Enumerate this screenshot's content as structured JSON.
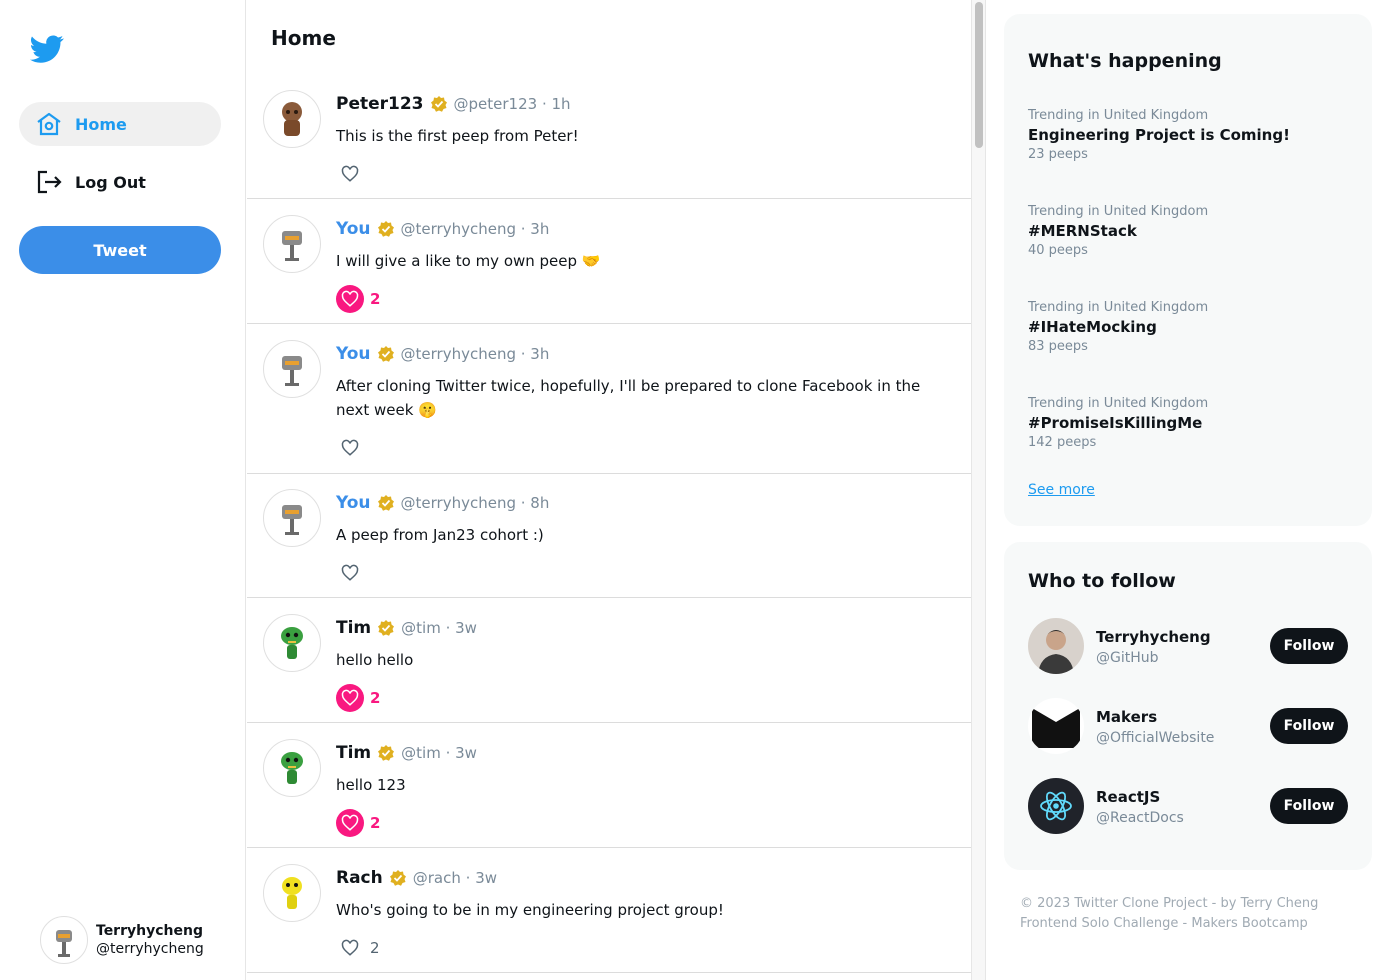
{
  "sidebar": {
    "nav": [
      {
        "label": "Home",
        "icon": "home-icon",
        "active": true
      },
      {
        "label": "Log Out",
        "icon": "logout-icon",
        "active": false
      }
    ],
    "tweet_label": "Tweet",
    "me": {
      "name": "Terryhycheng",
      "handle": "@terryhycheng"
    }
  },
  "feed": {
    "title": "Home",
    "peeps": [
      {
        "name": "Peter123",
        "you": false,
        "handle": "@peter123",
        "time": "1h",
        "text": "This is the first peep from Peter!",
        "likes": "",
        "liked": false
      },
      {
        "name": "You",
        "you": true,
        "handle": "@terryhycheng",
        "time": "3h",
        "text": "I will give a like to my own peep 🤝",
        "likes": "2",
        "liked": true
      },
      {
        "name": "You",
        "you": true,
        "handle": "@terryhycheng",
        "time": "3h",
        "text": "After cloning Twitter twice, hopefully, I'll be prepared to clone Facebook in the next week 🤫",
        "likes": "",
        "liked": false
      },
      {
        "name": "You",
        "you": true,
        "handle": "@terryhycheng",
        "time": "8h",
        "text": "A peep from Jan23 cohort :)",
        "likes": "",
        "liked": false
      },
      {
        "name": "Tim",
        "you": false,
        "handle": "@tim",
        "time": "3w",
        "text": "hello hello",
        "likes": "2",
        "liked": true
      },
      {
        "name": "Tim",
        "you": false,
        "handle": "@tim",
        "time": "3w",
        "text": "hello 123",
        "likes": "2",
        "liked": true
      },
      {
        "name": "Rach",
        "you": false,
        "handle": "@rach",
        "time": "3w",
        "text": "Who's going to be in my engineering project group!",
        "likes": "2",
        "liked": false
      }
    ]
  },
  "trends": {
    "title": "What's happening",
    "items": [
      {
        "context": "Trending in United Kingdom",
        "tag": "Engineering Project is Coming!",
        "count": "23 peeps"
      },
      {
        "context": "Trending in United Kingdom",
        "tag": "#MERNStack",
        "count": "40 peeps"
      },
      {
        "context": "Trending in United Kingdom",
        "tag": "#IHateMocking",
        "count": "83 peeps"
      },
      {
        "context": "Trending in United Kingdom",
        "tag": "#PromiseIsKillingMe",
        "count": "142 peeps"
      }
    ],
    "see_more": "See more"
  },
  "who_to_follow": {
    "title": "Who to follow",
    "items": [
      {
        "name": "Terryhycheng",
        "handle": "@GitHub",
        "button": "Follow"
      },
      {
        "name": "Makers",
        "handle": "@OfficialWebsite",
        "button": "Follow"
      },
      {
        "name": "ReactJS",
        "handle": "@ReactDocs",
        "button": "Follow"
      }
    ]
  },
  "footer": {
    "line1": "© 2023 Twitter Clone Project - by Terry Cheng",
    "line2": "Frontend Solo Challenge - Makers Bootcamp"
  },
  "colors": {
    "accent": "#3b8ee8",
    "like": "#f91880",
    "verified": "#e0b020"
  }
}
